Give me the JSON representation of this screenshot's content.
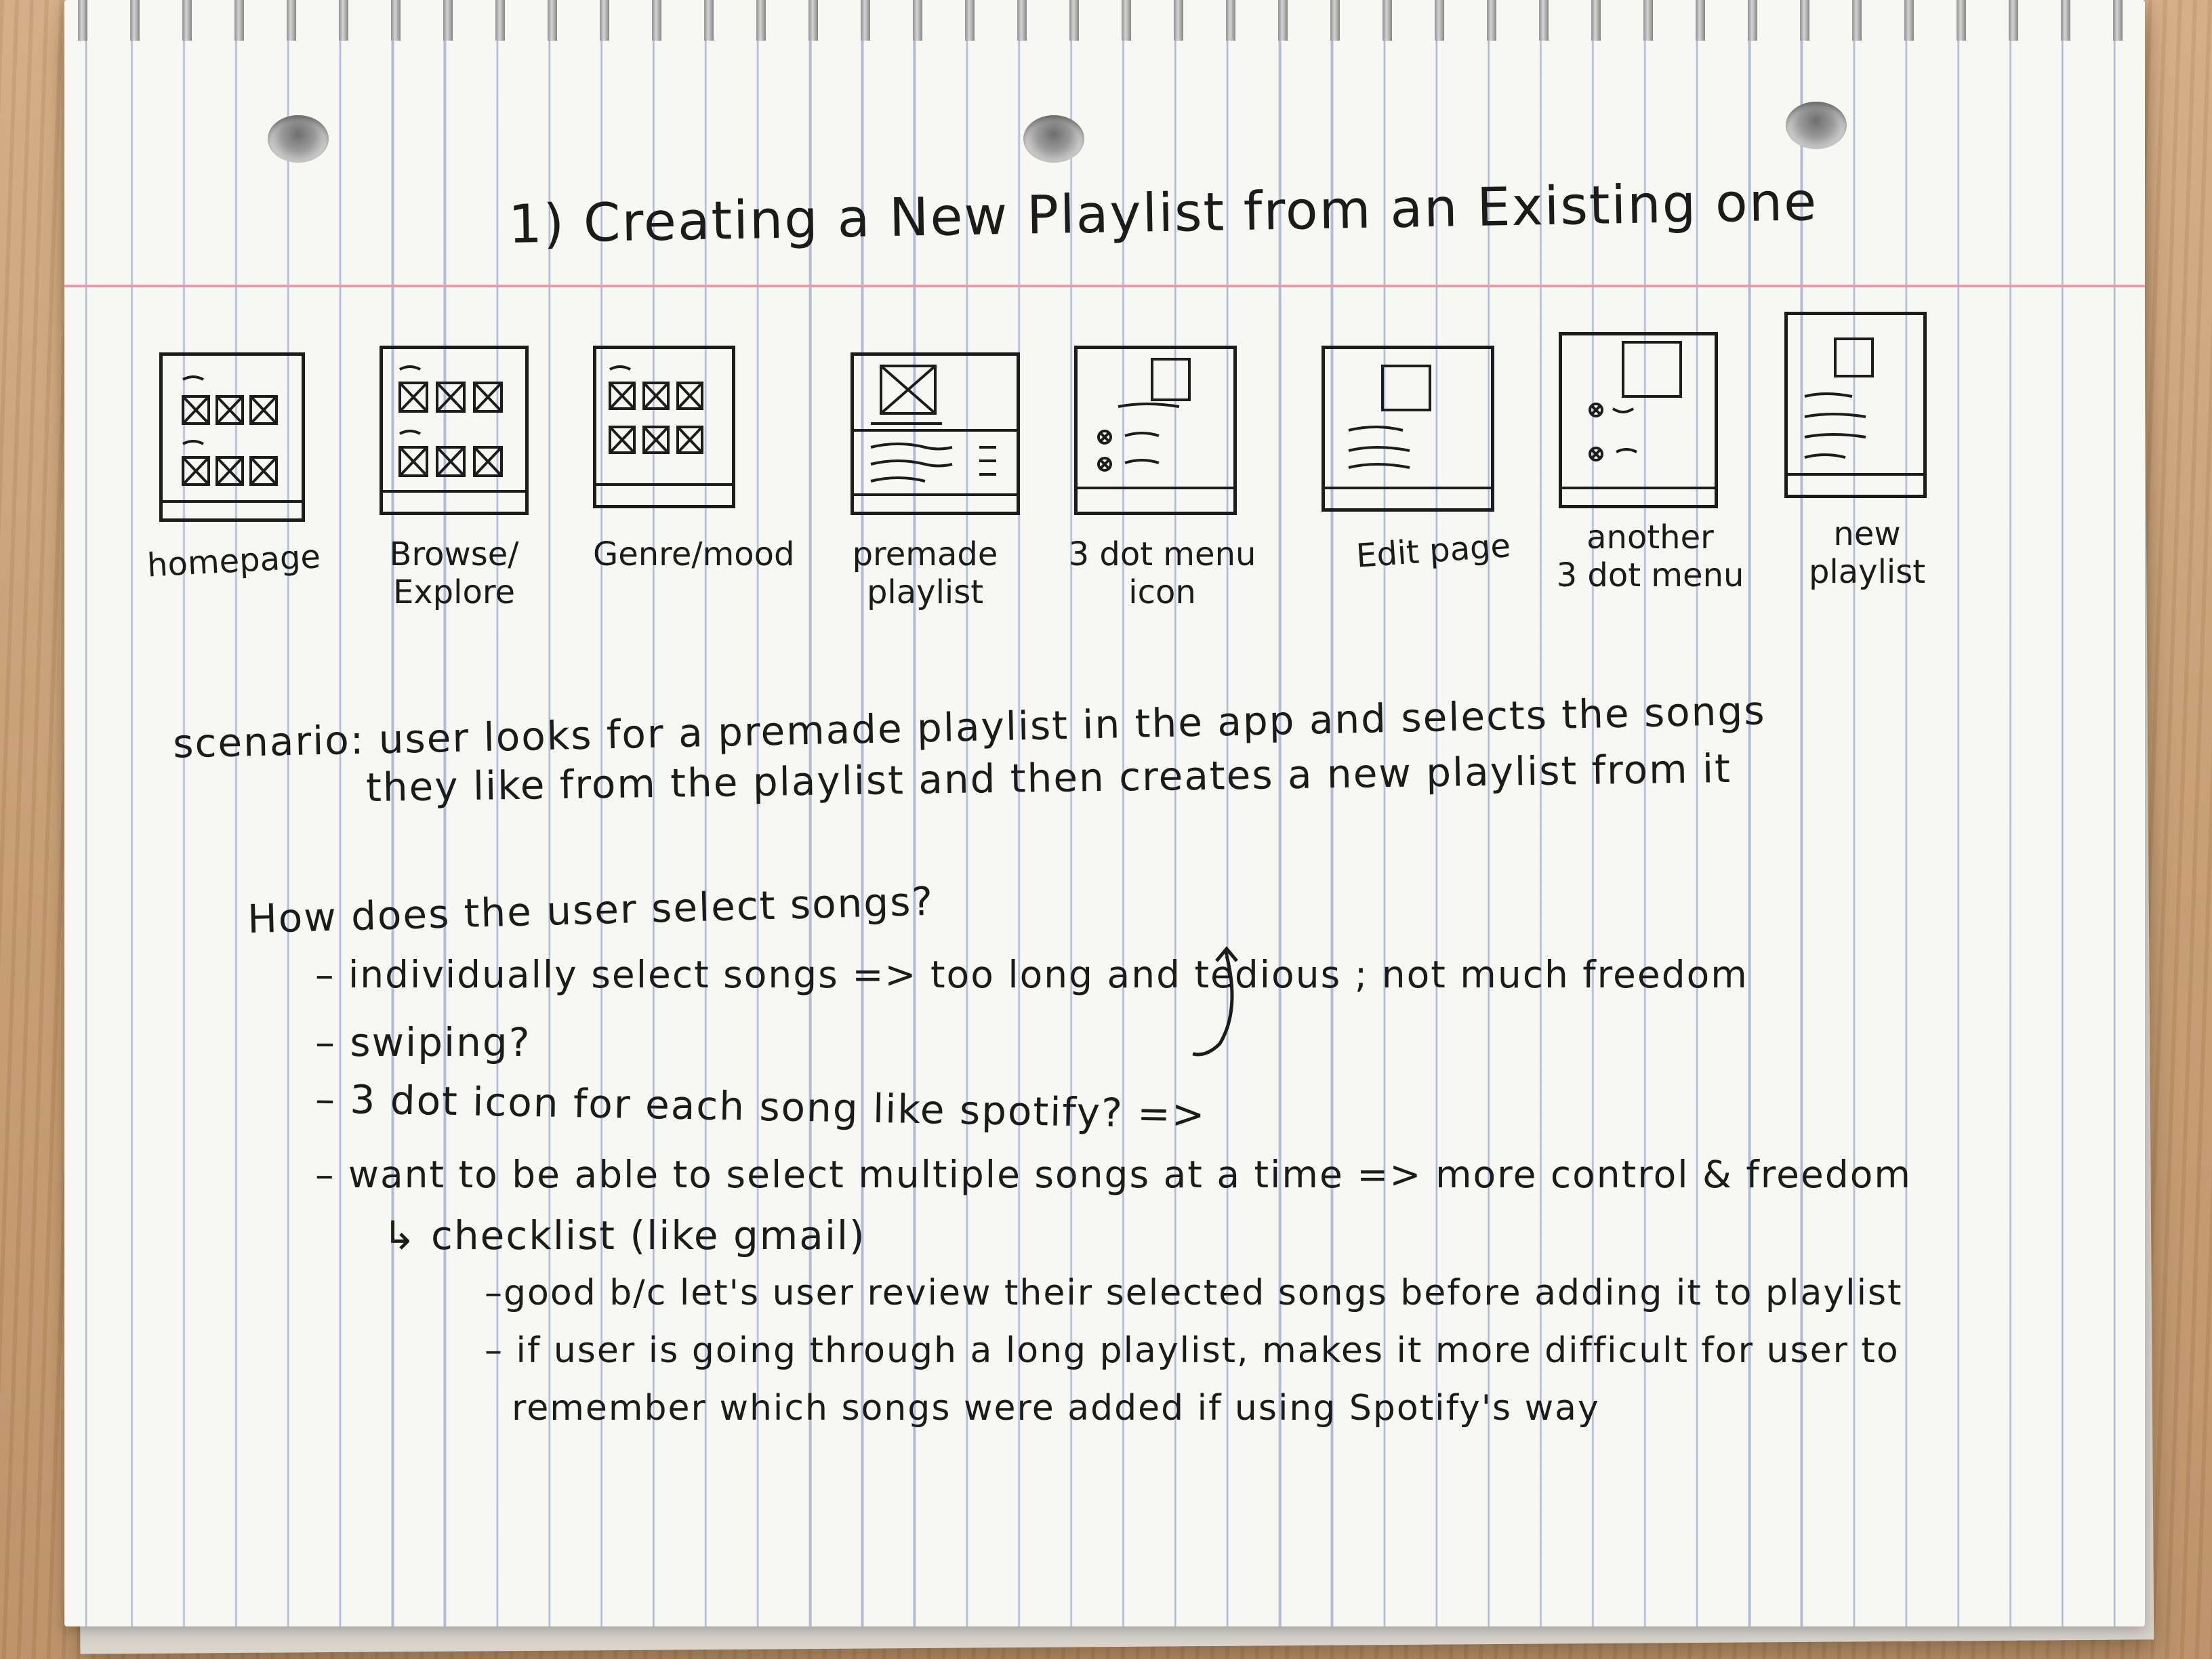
{
  "title": "1) Creating a New Playlist from an Existing one",
  "storyboard": [
    {
      "id": "homepage",
      "label_lines": [
        "homepage"
      ]
    },
    {
      "id": "browse-explore",
      "label_lines": [
        "Browse/",
        "Explore"
      ]
    },
    {
      "id": "genre-mood",
      "label_lines": [
        "Genre/mood"
      ]
    },
    {
      "id": "premade-playlist",
      "label_lines": [
        "premade",
        "playlist"
      ]
    },
    {
      "id": "three-dot-menu-icon",
      "label_lines": [
        "3 dot menu",
        "icon"
      ]
    },
    {
      "id": "edit-page",
      "label_lines": [
        "Edit page"
      ]
    },
    {
      "id": "another-three-dot-menu",
      "label_lines": [
        "another",
        "3 dot menu"
      ]
    },
    {
      "id": "new-playlist",
      "label_lines": [
        "new",
        "playlist"
      ]
    }
  ],
  "notes": {
    "scenario_line1": "scenario: user looks for a premade playlist in the app and selects the songs",
    "scenario_line2": "they like from the playlist and then creates a new playlist from it",
    "question": "How does the user select songs?",
    "bullet1": "– individually select songs => too long and tedious ; not much freedom",
    "bullet2": "– swiping?",
    "bullet3": "– 3 dot icon for each song like spotify? =>",
    "bullet4": "– want to be able to select multiple songs at a time => more control & freedom",
    "sub1": "↳ checklist (like gmail)",
    "sub1a": "–good b/c let's user review their selected songs before adding it to playlist",
    "sub1b": "– if user is going through a long playlist, makes it more difficult for user to",
    "sub1b_cont": "remember which songs were added if using Spotify's way"
  }
}
